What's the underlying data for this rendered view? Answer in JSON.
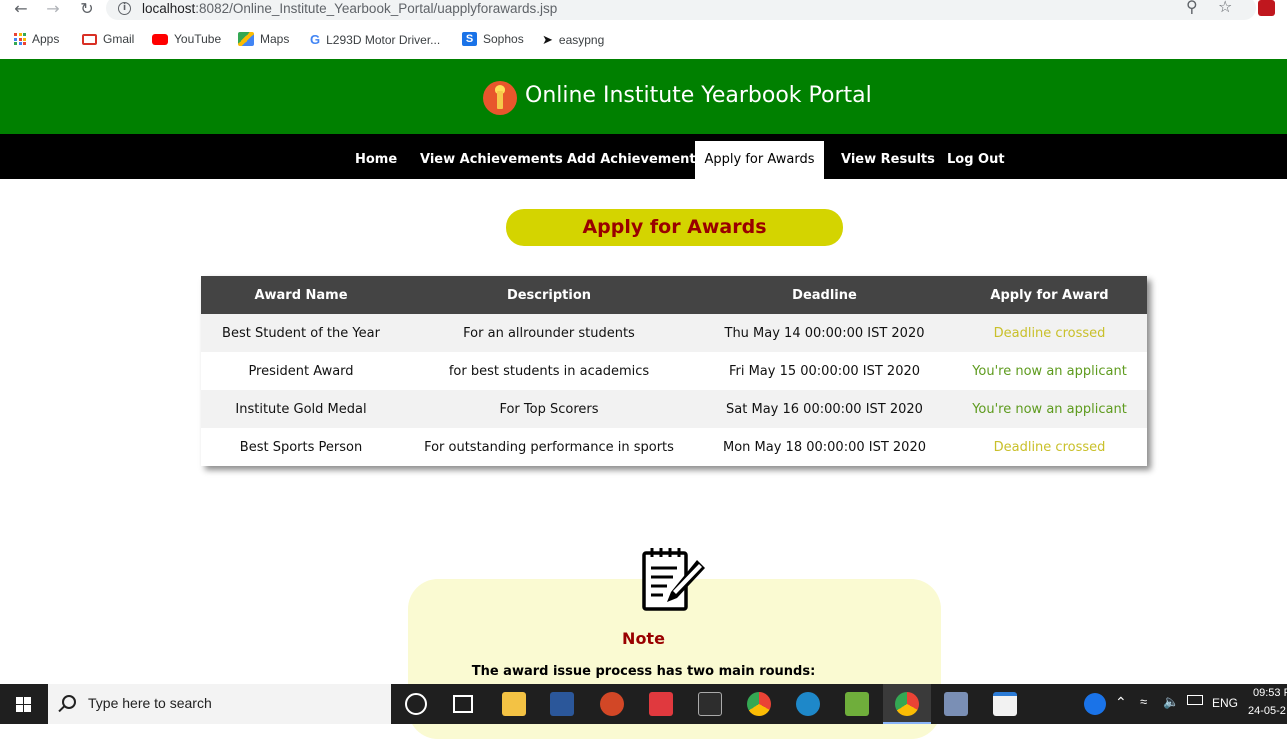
{
  "browser": {
    "url_host": "localhost",
    "url_rest": ":8082/Online_Institute_Yearbook_Portal/uapplyforawards.jsp",
    "bookmarks": [
      {
        "label": "Apps",
        "color": "#4285f4"
      },
      {
        "label": "Gmail",
        "color": "#d93025"
      },
      {
        "label": "YouTube",
        "color": "#ff0000"
      },
      {
        "label": "Maps",
        "color": "#34a853"
      },
      {
        "label": "L293D Motor Driver...",
        "color": "#4285f4"
      },
      {
        "label": "Sophos",
        "color": "#1a73e8"
      },
      {
        "label": "easypng",
        "color": "#111111"
      }
    ]
  },
  "site": {
    "title": "Online Institute Yearbook Portal",
    "nav": [
      {
        "label": "Home",
        "active": false
      },
      {
        "label": "View Achievements",
        "active": false
      },
      {
        "label": "Add Achievements",
        "active": false
      },
      {
        "label": "Apply for Awards",
        "active": true
      },
      {
        "label": "View Results",
        "active": false
      },
      {
        "label": "Log Out",
        "active": false
      }
    ]
  },
  "page": {
    "heading": "Apply for Awards",
    "table": {
      "headers": [
        "Award Name",
        "Description",
        "Deadline",
        "Apply for Award"
      ],
      "rows": [
        {
          "name": "Best Student of the Year",
          "description": "For an allrounder students",
          "deadline": "Thu May 14 00:00:00 IST 2020",
          "status": "Deadline crossed",
          "status_type": "crossed"
        },
        {
          "name": "President Award",
          "description": "for best students in academics",
          "deadline": "Fri May 15 00:00:00 IST 2020",
          "status": "You're now an applicant",
          "status_type": "applicant"
        },
        {
          "name": "Institute Gold Medal",
          "description": "For Top Scorers",
          "deadline": "Sat May 16 00:00:00 IST 2020",
          "status": "You're now an applicant",
          "status_type": "applicant"
        },
        {
          "name": "Best Sports Person",
          "description": "For outstanding performance in sports",
          "deadline": "Mon May 18 00:00:00 IST 2020",
          "status": "Deadline crossed",
          "status_type": "crossed"
        }
      ]
    },
    "note": {
      "title": "Note",
      "text": "The award issue process has two main rounds:"
    }
  },
  "taskbar": {
    "search_placeholder": "Type here to search",
    "language": "ENG",
    "time": "09:53 P",
    "date": "24-05-2"
  },
  "colors": {
    "header_green": "#008000",
    "heading_pill": "#d4d400",
    "heading_text": "#990000",
    "deadline_crossed": "#c9c02a",
    "applicant": "#5e9b1e"
  }
}
